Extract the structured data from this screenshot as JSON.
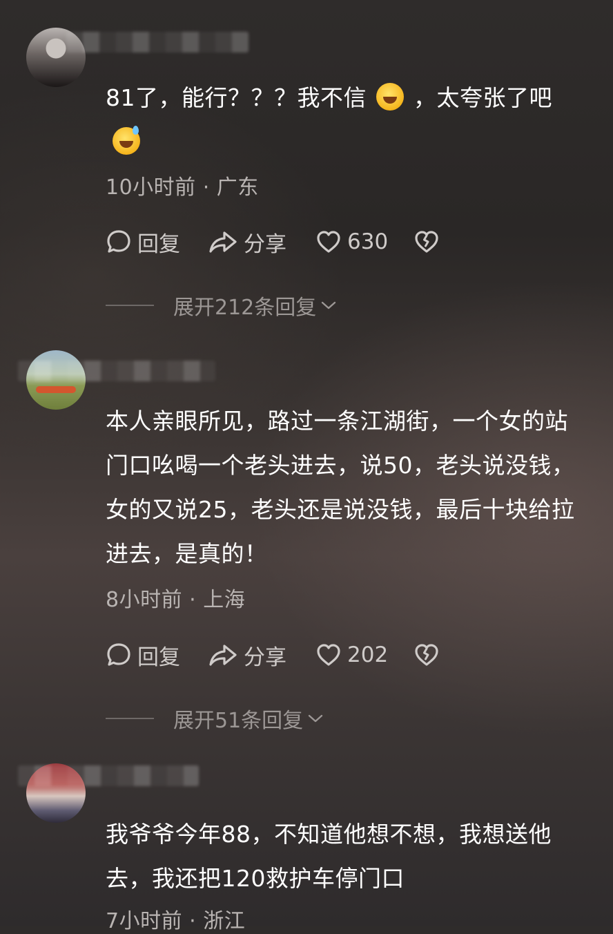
{
  "comments": [
    {
      "text_before_emoji": "81了，能行？？？我不信",
      "emoji_1": "rolling-laughing-emoji",
      "text_after_emoji": "，太夸张了吧",
      "emoji_2": "grinning-sweat-emoji",
      "meta": "10小时前 · 广东",
      "reply_label": "回复",
      "share_label": "分享",
      "likes": "630",
      "expand_label": "展开212条回复"
    },
    {
      "lines": [
        "本人亲眼所见，路过一条江湖街，一个女的站",
        "门口吆喝一个老头进去，说50，老头说没钱，",
        "女的又说25，老头还是说没钱，最后十块给拉",
        "进去，是真的！"
      ],
      "meta": "8小时前 · 上海",
      "reply_label": "回复",
      "share_label": "分享",
      "likes": "202",
      "expand_label": "展开51条回复"
    },
    {
      "lines": [
        "我爷爷今年88，不知道他想不想，我想送他",
        "去，我还把120救护车停门口"
      ],
      "meta": "7小时前 · 浙江"
    }
  ],
  "colors": {
    "text_primary": "#ffffff",
    "text_secondary": "#b9b4b2",
    "text_muted": "#9c9795",
    "icon": "#cfcbc9"
  }
}
